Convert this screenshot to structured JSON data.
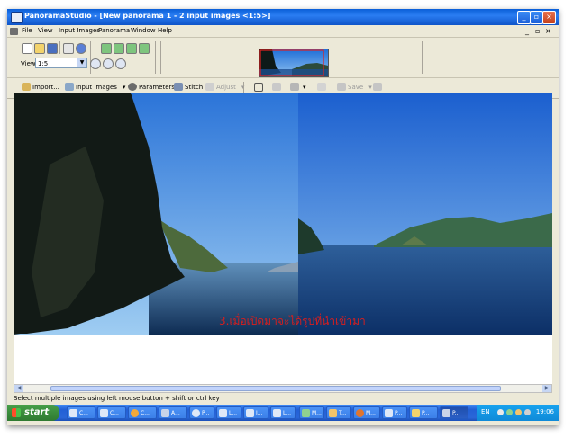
{
  "window": {
    "title": "PanoramaStudio - [New panorama 1 - 2 input images <1:5>]"
  },
  "menu": {
    "items": [
      "File",
      "View",
      "Input Images",
      "Panorama",
      "Window",
      "Help"
    ]
  },
  "view": {
    "label": "View:",
    "zoom": "1:5"
  },
  "toolbar": {
    "import_label": "Import...",
    "input_images_label": "Input Images",
    "parameters_label": "Parameters",
    "stitch_label": "Stitch",
    "adjust_label": "Adjust",
    "save_label": "Save"
  },
  "canvas": {
    "caption": "3.เมื่อเปิดมาจะได้รูปที่นำเข้ามา"
  },
  "status": {
    "text": "Select multiple images using left mouse button + shift or ctrl key"
  },
  "taskbar": {
    "start_label": "start",
    "tasks": [
      "C...",
      "C...",
      "C...",
      "A...",
      "P...",
      "L...",
      "I...",
      "L...",
      "M...",
      "T...",
      "M...",
      "P...",
      "P...",
      "P..."
    ],
    "language": "EN",
    "clock": "19:06"
  },
  "colors": {
    "title_bar": "#0a5fd8",
    "caption": "#d81e1e",
    "start_button": "#3a8c3c",
    "taskbar": "#2260d6"
  }
}
